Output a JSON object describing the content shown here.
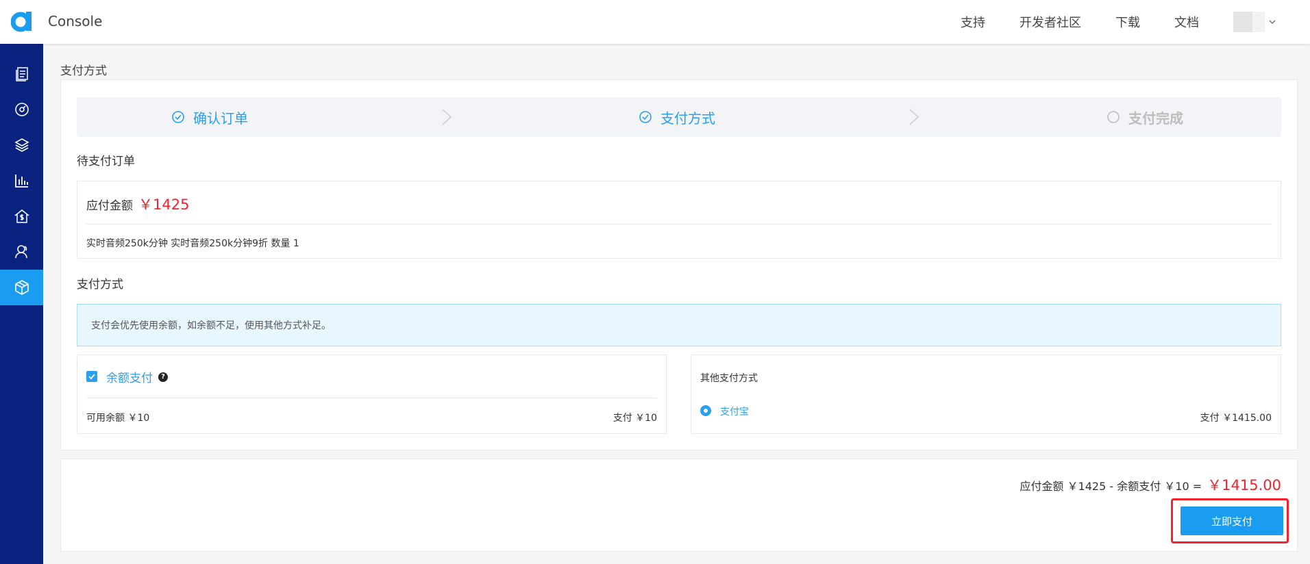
{
  "header": {
    "app_title": "Console",
    "nav": [
      "支持",
      "开发者社区",
      "下载",
      "文档"
    ]
  },
  "sidebar": {
    "items": [
      {
        "icon": "document-list-icon"
      },
      {
        "icon": "dashboard-gauge-icon"
      },
      {
        "icon": "layers-icon"
      },
      {
        "icon": "bar-chart-icon"
      },
      {
        "icon": "billing-house-icon"
      },
      {
        "icon": "user-icon"
      },
      {
        "icon": "package-icon",
        "active": true
      }
    ]
  },
  "page": {
    "title": "支付方式"
  },
  "steps": [
    {
      "label": "确认订单",
      "status": "done"
    },
    {
      "label": "支付方式",
      "status": "done"
    },
    {
      "label": "支付完成",
      "status": "pending"
    }
  ],
  "order": {
    "section_title": "待支付订单",
    "amount_label": "应付金额",
    "amount_value": "￥1425",
    "detail": "实时音频250k分钟 实时音频250k分钟9折 数量 1"
  },
  "payment": {
    "section_title": "支付方式",
    "notice": "支付会优先使用余额，如余额不足，使用其他方式补足。",
    "balance": {
      "label": "余额支付",
      "available": "可用余额 ￥10",
      "pay": "支付 ￥10",
      "checked": true
    },
    "other": {
      "title": "其他支付方式",
      "option": "支付宝",
      "pay": "支付 ￥1415.00",
      "selected": true
    }
  },
  "summary": {
    "formula": "应付金额 ￥1425 - 余额支付 ￥10 =",
    "total": "￥1415.00",
    "button_label": "立即支付"
  },
  "colors": {
    "accent": "#1a9cf0",
    "sidebar": "#0b2380",
    "price": "#f5222d"
  }
}
